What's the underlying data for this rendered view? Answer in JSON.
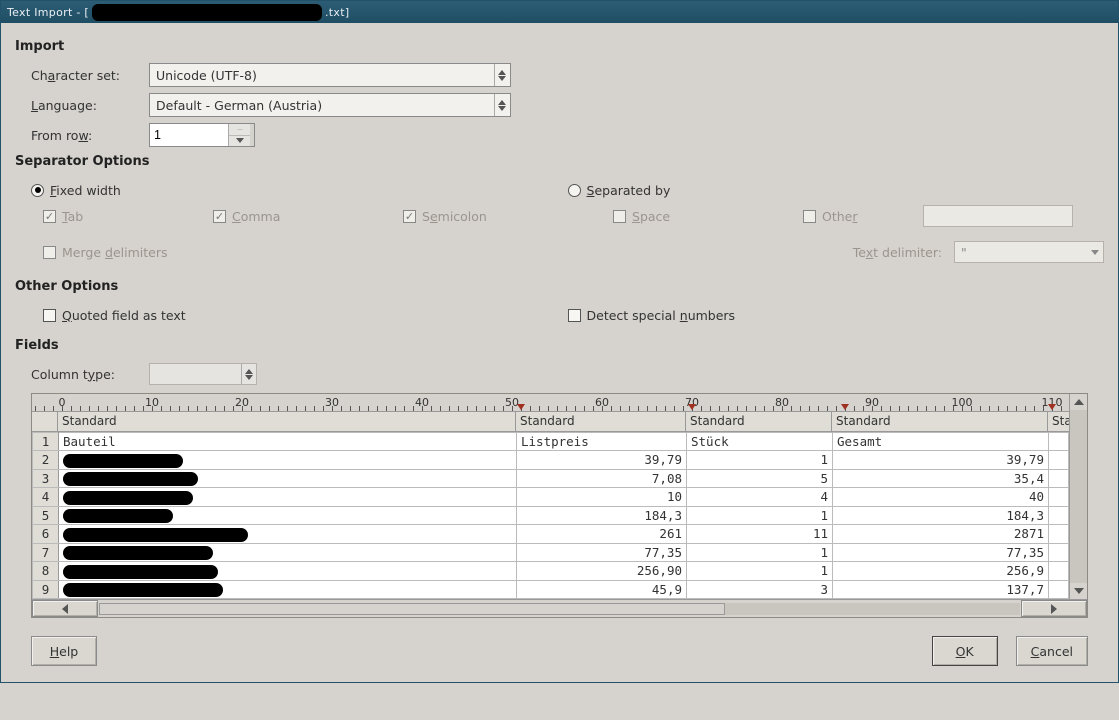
{
  "titlebar": {
    "prefix": "Text Import - [",
    "suffix": ".txt]"
  },
  "import": {
    "heading": "Import",
    "charset_label_pre": "Ch",
    "charset_label_u": "a",
    "charset_label_post": "racter set:",
    "charset_value": "Unicode (UTF-8)",
    "language_label_u": "L",
    "language_label_post": "anguage:",
    "language_value": "Default - German (Austria)",
    "fromrow_label_pre": "From ro",
    "fromrow_label_u": "w",
    "fromrow_label_post": ":",
    "fromrow_value": "1"
  },
  "separator": {
    "heading": "Separator Options",
    "fixed_u": "F",
    "fixed_post": "ixed width",
    "sep_u": "S",
    "sep_post": "eparated by",
    "tab_u": "T",
    "tab_post": "ab",
    "comma_u": "C",
    "comma_post": "omma",
    "semi_pre": "S",
    "semi_u": "e",
    "semi_post": "micolon",
    "space_u": "S",
    "space_post": "pace",
    "other_pre": "Othe",
    "other_u": "r",
    "merge_pre": "Merge ",
    "merge_u": "d",
    "merge_post": "elimiters",
    "tdelim_pre": "Te",
    "tdelim_u": "x",
    "tdelim_post": "t delimiter:",
    "tdelim_value": "\""
  },
  "other": {
    "heading": "Other Options",
    "quoted_u": "Q",
    "quoted_post": "uoted field as text",
    "detect_pre": "Detect special ",
    "detect_u": "n",
    "detect_post": "umbers"
  },
  "fields": {
    "heading": "Fields",
    "coltype_pre": "Column t",
    "coltype_u": "y",
    "coltype_post": "pe:"
  },
  "ruler_numbers": [
    "0",
    "10",
    "20",
    "30",
    "40",
    "50",
    "60",
    "70",
    "80",
    "90",
    "100",
    "110"
  ],
  "column_headers": [
    "Standard",
    "Standard",
    "Standard",
    "Standard",
    "Standard",
    "Stan"
  ],
  "table_header_row": [
    "Bauteil",
    "Listpreis",
    "Stück",
    "Gesamt",
    ""
  ],
  "rows": [
    {
      "n": "1"
    },
    {
      "n": "2",
      "c1": "39,79",
      "c2": "1",
      "c3": "39,79"
    },
    {
      "n": "3",
      "c1": "7,08",
      "c2": "5",
      "c3": "35,4"
    },
    {
      "n": "4",
      "c1": "10",
      "c2": "4",
      "c3": "40"
    },
    {
      "n": "5",
      "c1": "184,3",
      "c2": "1",
      "c3": "184,3"
    },
    {
      "n": "6",
      "c1": "261",
      "c2": "11",
      "c3": "2871"
    },
    {
      "n": "7",
      "c1": "77,35",
      "c2": "1",
      "c3": "77,35"
    },
    {
      "n": "8",
      "c1": "256,90",
      "c2": "1",
      "c3": "256,9"
    },
    {
      "n": "9",
      "c1": "45,9",
      "c2": "3",
      "c3": "137,7"
    }
  ],
  "buttons": {
    "help_u": "H",
    "help_post": "elp",
    "ok_u": "O",
    "ok_post": "K",
    "cancel_u": "C",
    "cancel_post": "ancel"
  }
}
